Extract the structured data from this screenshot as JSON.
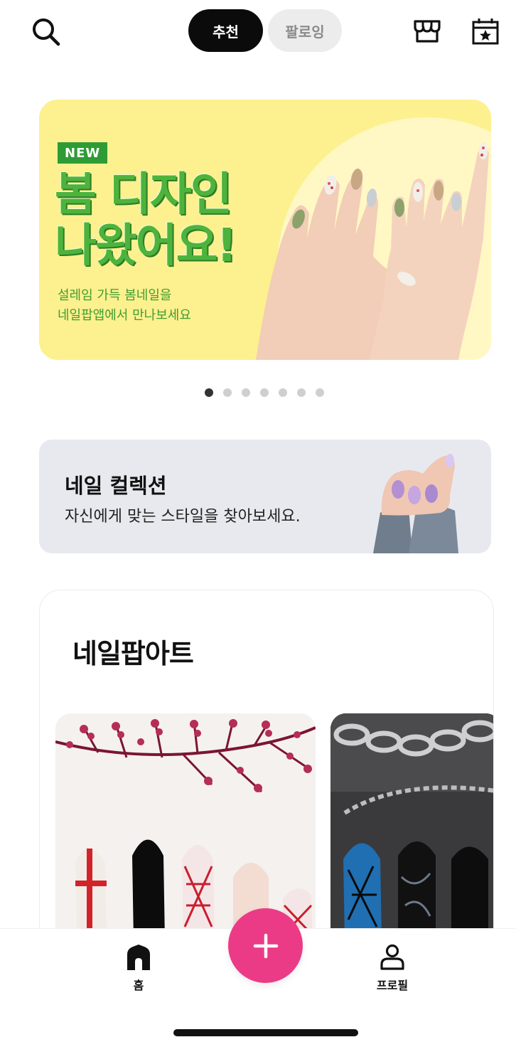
{
  "header": {
    "tabs": [
      {
        "label": "추천",
        "active": true
      },
      {
        "label": "팔로잉",
        "active": false
      }
    ],
    "icons": [
      "search-icon",
      "shop-icon",
      "calendar-star-icon"
    ]
  },
  "banner": {
    "badge": "NEW",
    "headline_line1": "봄 디자인",
    "headline_line2": "나왔어요!",
    "sub_line1": "설레임 가득 봄네일을",
    "sub_line2": "네일팝앱에서 만나보세요",
    "bg_color": "#fdf08f",
    "text_color": "#4db33c"
  },
  "carousel": {
    "total": 7,
    "active_index": 0
  },
  "collection": {
    "title": "네일 컬렉션",
    "description": "자신에게 맞는 스타일을 찾아보세요."
  },
  "popart": {
    "title": "네일팝아트"
  },
  "bottom_nav": {
    "home_label": "홈",
    "profile_label": "프로필",
    "fab_color": "#ec3b86"
  }
}
